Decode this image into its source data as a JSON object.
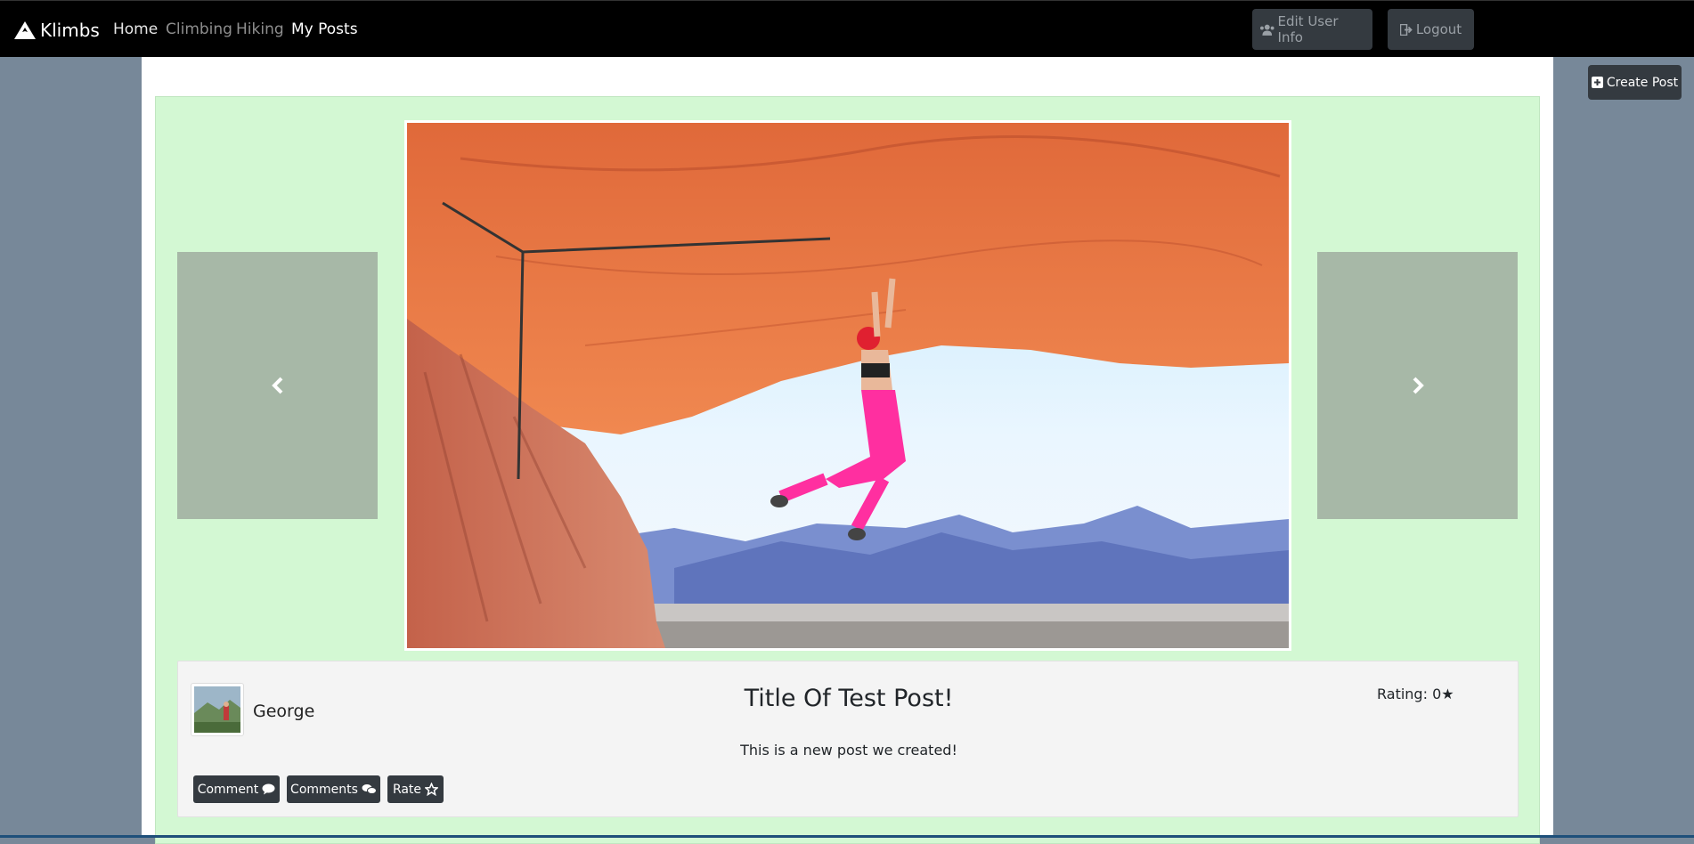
{
  "navbar": {
    "brand": "Klimbs",
    "links": [
      {
        "label": "Home",
        "active": false
      },
      {
        "label": "Climbing",
        "active": false
      },
      {
        "label": "Hiking",
        "active": false
      },
      {
        "label": "My Posts",
        "active": true
      }
    ],
    "edit_user_label": "Edit User Info",
    "logout_label": "Logout"
  },
  "create_post_label": "Create Post",
  "post": {
    "author": "George",
    "title": "Title Of Test Post!",
    "rating_label": "Rating: 0★",
    "body": "This is a new post we created!",
    "buttons": {
      "comment": "Comment",
      "comments": "Comments",
      "rate": "Rate"
    }
  },
  "colors": {
    "navbar": "#000000",
    "page_bg": "#778899",
    "panel_bg": "#d3f8d3",
    "dark_button": "#343a40",
    "carousel_control": "#a7b8a7"
  },
  "icons": {
    "brand": "mountain-icon",
    "edit_user": "users-icon",
    "logout": "sign-out-icon",
    "create_post": "plus-square-icon",
    "prev": "chevron-left-icon",
    "next": "chevron-right-icon",
    "comment": "comment-icon",
    "comments": "comments-icon",
    "rate": "star-icon"
  }
}
